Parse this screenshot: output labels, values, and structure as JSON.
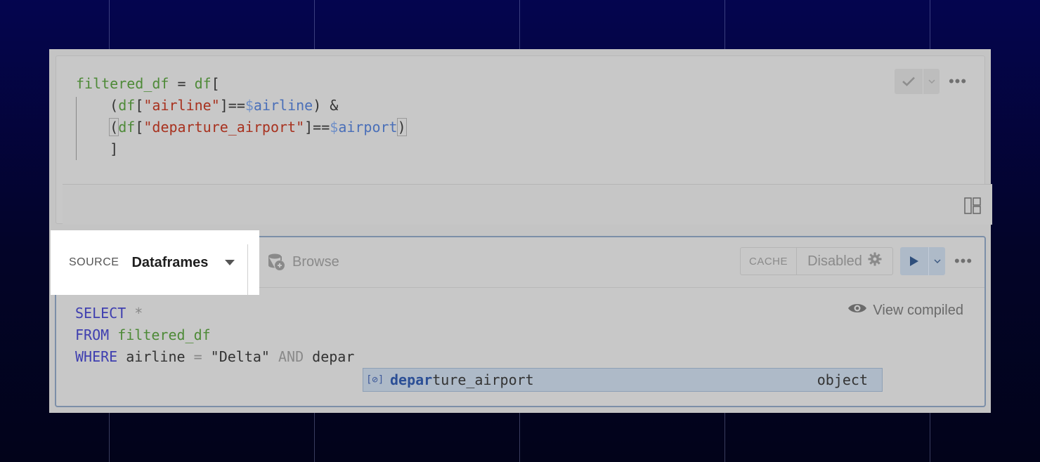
{
  "python_cell": {
    "code": {
      "line1_var": "filtered_df",
      "line1_eq": " = ",
      "line1_df": "df",
      "line1_open": "[",
      "line2_open": "(",
      "line2_df": "df",
      "line2_key_open": "[",
      "line2_key": "\"airline\"",
      "line2_key_close": "]==",
      "line2_dollar": "$",
      "line2_param": "airline",
      "line2_close": ") &",
      "line3_open": "(",
      "line3_df": "df",
      "line3_key_open": "[",
      "line3_key": "\"departure_airport\"",
      "line3_key_close": "]==",
      "line3_dollar": "$",
      "line3_param": "airport",
      "line3_close": ")",
      "line4": "]"
    },
    "actions": {
      "check_icon": "check-icon",
      "more": "•••"
    }
  },
  "sql_cell": {
    "source_label": "SOURCE",
    "source_value": "Dataframes",
    "browse_label": "Browse",
    "cache_label": "CACHE",
    "cache_value": "Disabled",
    "more": "•••",
    "view_compiled": "View compiled",
    "code": {
      "kw_select": "SELECT",
      "select_rest": " *",
      "kw_from": "FROM",
      "table": " filtered_df",
      "kw_where": "WHERE",
      "where_col": " airline ",
      "eq": "=",
      "value": " \"Delta\" ",
      "kw_and": "AND",
      "partial": " depar"
    },
    "autocomplete": {
      "icon": "[⊘]",
      "match": "depar",
      "rest": "ture_airport",
      "type": "object"
    }
  },
  "colors": {
    "background_top": "#04054f",
    "background_bottom": "#02031a",
    "active_border": "#7c8fa8",
    "keyword": "#3f3fb0",
    "table": "#4e8a38"
  }
}
